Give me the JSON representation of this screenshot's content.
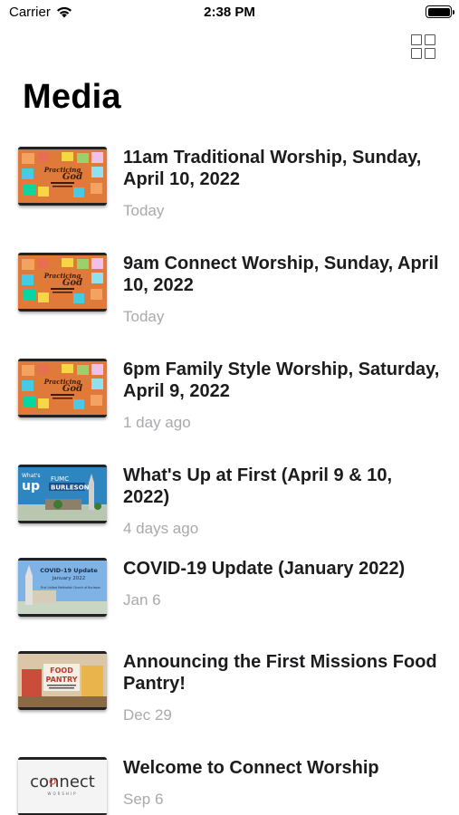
{
  "status_bar": {
    "carrier": "Carrier",
    "time": "2:38 PM",
    "battery_level": 1.0
  },
  "header": {
    "title": "Media",
    "layout_toggle_icon": "grid-icon"
  },
  "media_items": [
    {
      "title": "11am Traditional Worship, Sunday, April 10, 2022",
      "date": "Today",
      "thumbnail": "practicing-presence-of-god-sticky-notes"
    },
    {
      "title": "9am Connect Worship, Sunday, April 10, 2022",
      "date": "Today",
      "thumbnail": "practicing-presence-of-god-sticky-notes"
    },
    {
      "title": "6pm Family Style Worship, Saturday, April 9, 2022",
      "date": "1 day ago",
      "thumbnail": "practicing-presence-of-god-sticky-notes"
    },
    {
      "title": "What's Up at First (April 9 & 10, 2022)",
      "date": "4 days ago",
      "thumbnail": "whats-up-fumc-burleson"
    },
    {
      "title": "COVID-19 Update (January 2022)",
      "date": "Jan 6",
      "thumbnail": "covid-19-update-church"
    },
    {
      "title": "Announcing the First Missions Food Pantry!",
      "date": "Dec 29",
      "thumbnail": "food-pantry-store"
    },
    {
      "title": "Welcome to Connect Worship",
      "date": "Sep 6",
      "thumbnail": "connect-worship-logo"
    }
  ],
  "thumb_text": {
    "whats_up": "What's",
    "whats_up_big": "up",
    "fumc": "FUMC",
    "burleson": "BURLESON",
    "covid_title": "COVID-19 Update",
    "covid_month": "January 2022",
    "covid_church": "First United Methodist Church of Burleson",
    "food": "FOOD",
    "pantry": "PANTRY",
    "connect": "connect",
    "worship": "WORSHIP"
  }
}
